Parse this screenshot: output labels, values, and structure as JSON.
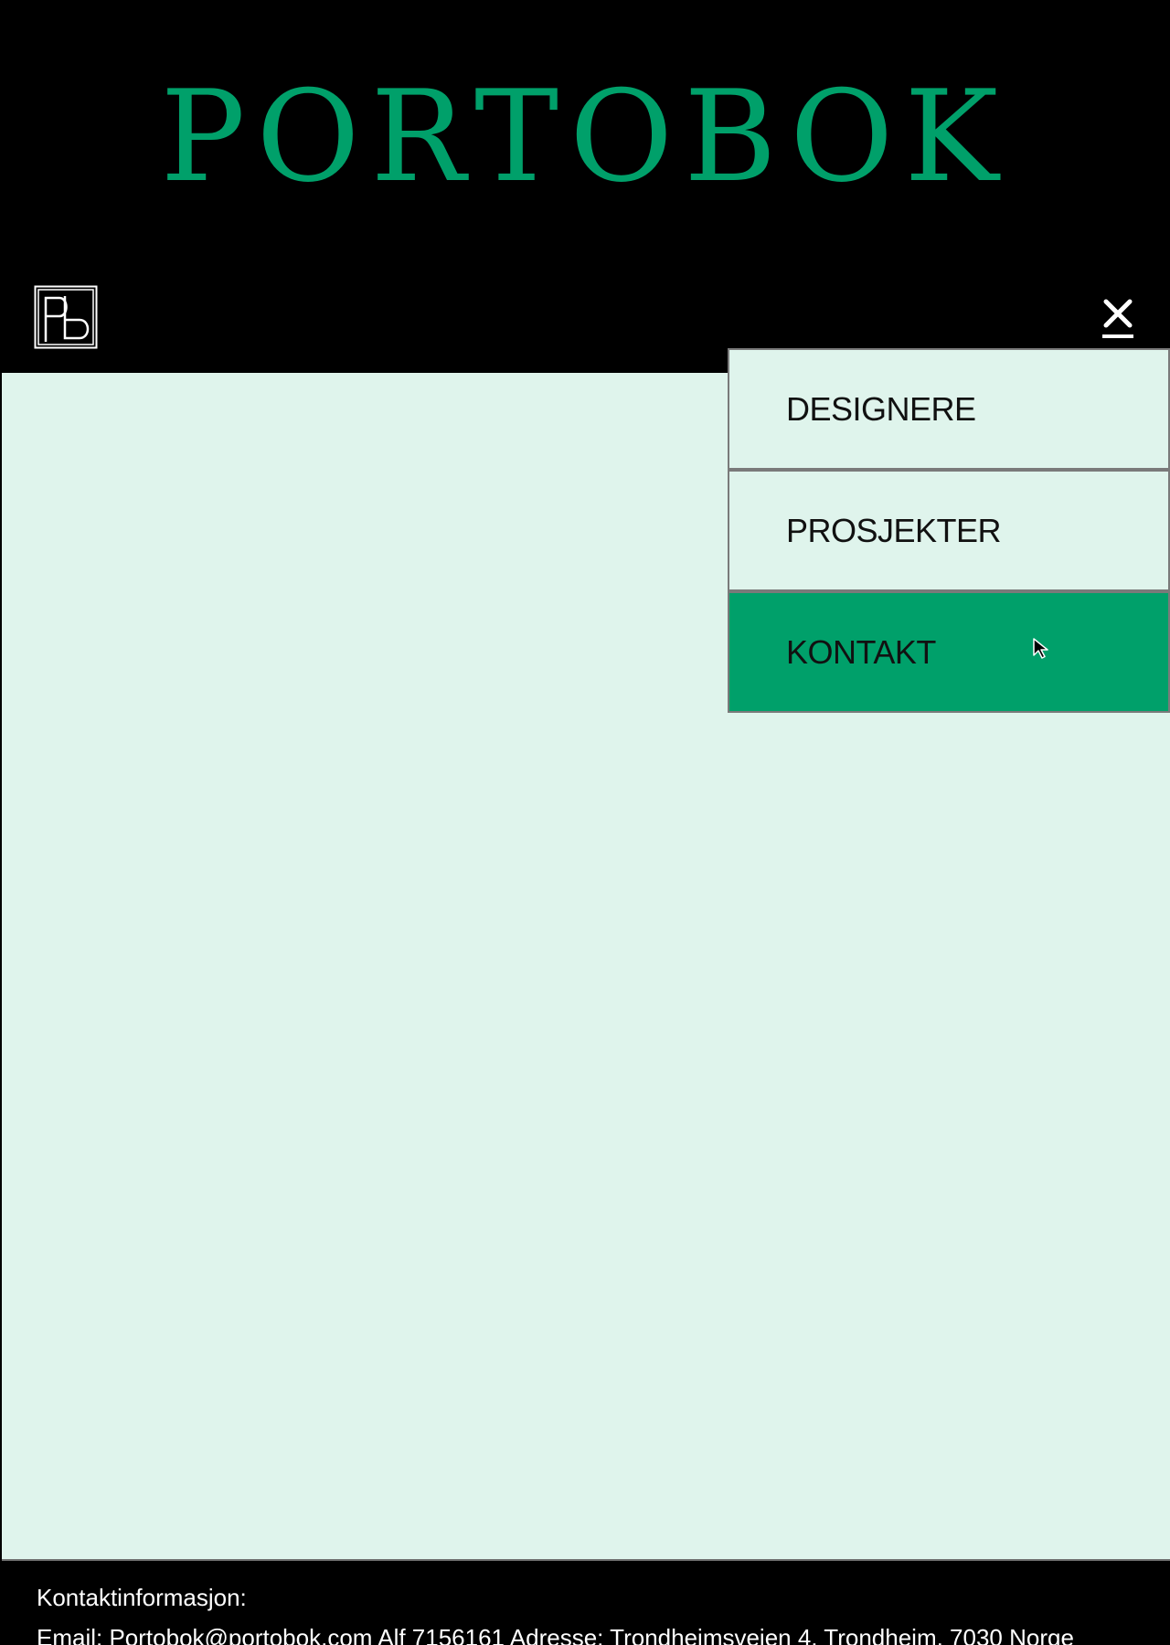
{
  "header": {
    "site_title": "PORTOBOK",
    "logo_text": "Pb",
    "close_icon": "close-icon"
  },
  "nav": {
    "items": [
      {
        "label": "DESIGNERE",
        "active": false
      },
      {
        "label": "PROSJEKTER",
        "active": false
      },
      {
        "label": "KONTAKT",
        "active": true
      }
    ]
  },
  "footer": {
    "heading": "Kontaktinformasjon:",
    "details": "Email: Portobok@portobok.com  Alf 7156161 Adresse: Trondheimsveien 4, Trondheim, 7030 Norge"
  },
  "colors": {
    "brand_green": "#00a06a",
    "page_background": "#dff4ec",
    "header_background": "#000000"
  }
}
